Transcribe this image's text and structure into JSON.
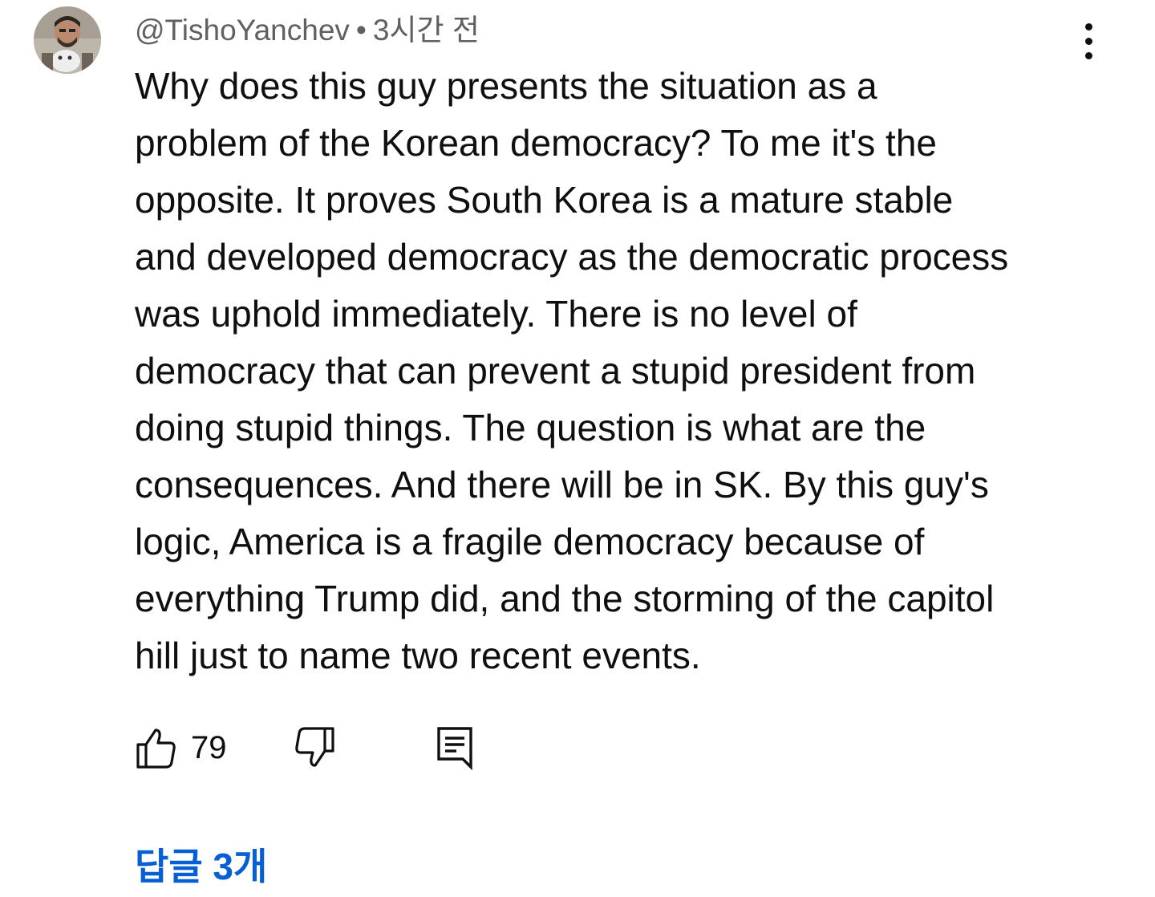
{
  "comment": {
    "author": "@TishoYanchev",
    "separator": "•",
    "time": "3시간 전",
    "text": "Why does this guy presents the situation as a\nproblem of the Korean democracy? To me it's the\nopposite. It proves South Korea is a mature stable\nand developed democracy as the democratic process\nwas uphold immediately. There is no level of\ndemocracy that can prevent a stupid president from\ndoing stupid things. The question is what are the\nconsequences. And there will be in SK. By this guy's\nlogic, America is a fragile democracy because of\neverything Trump did, and the storming of the capitol\nhill just to name two recent events.",
    "likes": "79",
    "replies_label": "답글 3개"
  },
  "icons": {
    "more": "more-vertical-icon",
    "like": "thumbs-up-icon",
    "dislike": "thumbs-down-icon",
    "reply": "reply-comment-icon"
  },
  "colors": {
    "text": "#0f0f0f",
    "secondary_text": "#606060",
    "link": "#065fd4"
  }
}
